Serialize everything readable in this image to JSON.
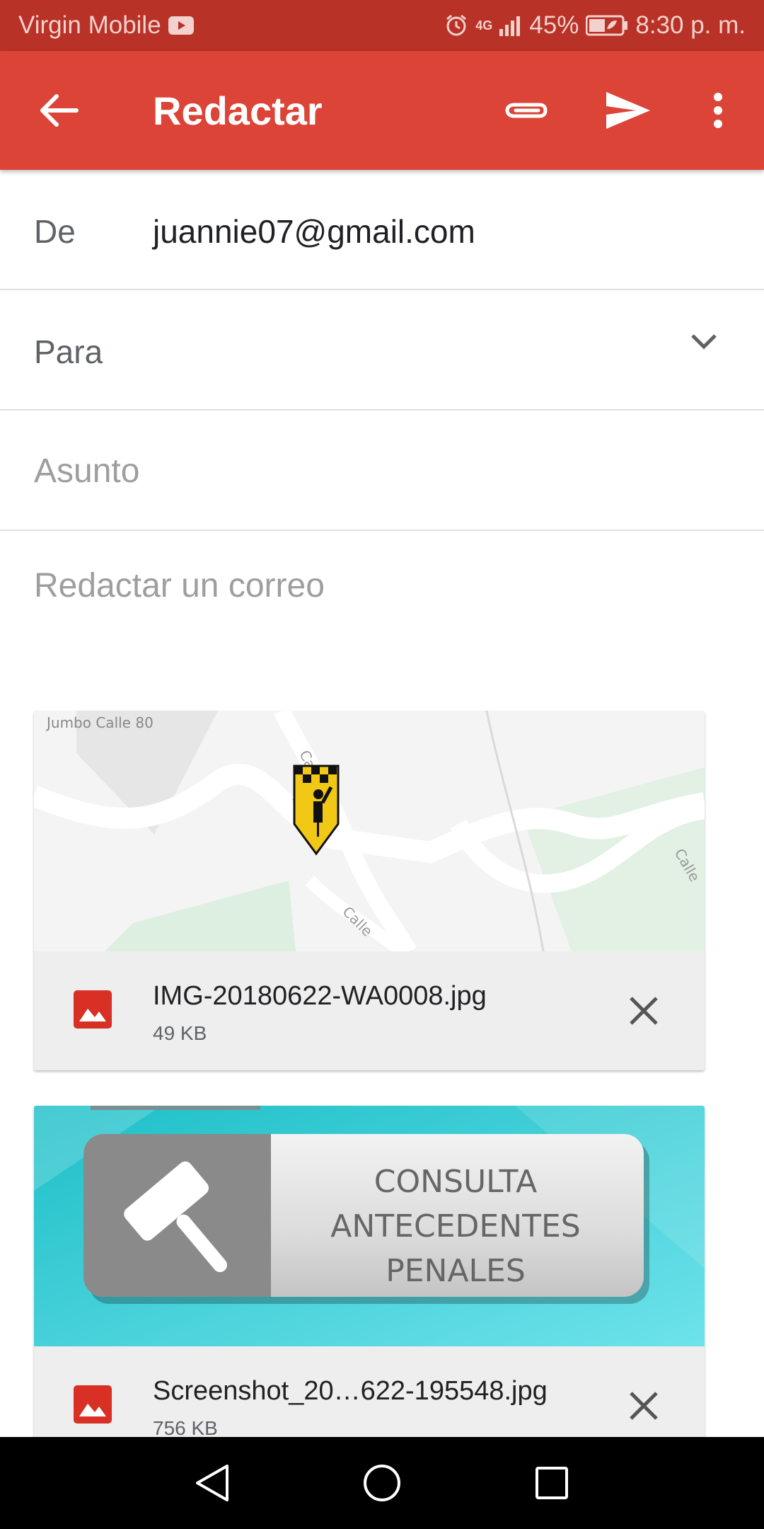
{
  "status_bar": {
    "carrier": "Virgin Mobile",
    "network": "4G",
    "battery": "45%",
    "time": "8:30 p. m.",
    "icons": [
      "youtube-icon",
      "alarm-icon",
      "signal-icon",
      "battery-icon"
    ]
  },
  "toolbar": {
    "title": "Redactar",
    "icons": [
      "back-arrow-icon",
      "paperclip-icon",
      "send-icon",
      "more-vert-icon"
    ]
  },
  "compose": {
    "from_label": "De",
    "from_value": "juannie07@gmail.com",
    "to_label": "Para",
    "subject_placeholder": "Asunto",
    "body_placeholder": "Redactar un correo"
  },
  "attachments": [
    {
      "name": "IMG-20180622-WA0008.jpg",
      "size": "49 KB",
      "preview_labels": [
        "Jumbo Calle 80",
        "Calle 80",
        "Calle",
        "Calle"
      ]
    },
    {
      "name": "Screenshot_20…622-195548.jpg",
      "size": "756 KB",
      "preview_lines": [
        "CONSULTA",
        "ANTECEDENTES",
        "PENALES"
      ]
    }
  ],
  "nav_bar": {
    "icons": [
      "back-triangle-icon",
      "home-circle-icon",
      "recents-square-icon"
    ]
  },
  "colors": {
    "status_bar": "#b83227",
    "toolbar": "#db4437",
    "attachment_icon": "#d93025",
    "preview_teal": "#3fc8d4"
  }
}
